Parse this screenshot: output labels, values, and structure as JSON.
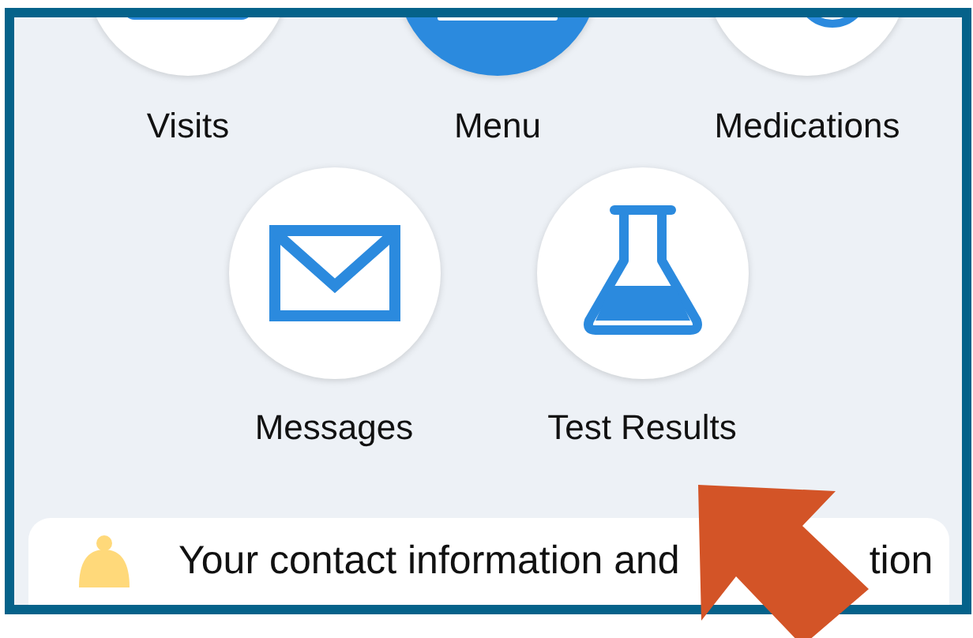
{
  "tiles_row_1": [
    {
      "label": "Visits",
      "kind": "calendar",
      "highlighted": false
    },
    {
      "label": "Menu",
      "kind": "menu",
      "highlighted": true
    },
    {
      "label": "Medications",
      "kind": "pills",
      "highlighted": false
    }
  ],
  "tiles_row_2": [
    {
      "label": "Messages",
      "kind": "envelope",
      "highlighted": false
    },
    {
      "label": "Test Results",
      "kind": "flask",
      "highlighted": false
    }
  ],
  "notice_card": {
    "kind": "bell",
    "text_fragments": [
      "Your contact information and",
      "tion"
    ]
  }
}
